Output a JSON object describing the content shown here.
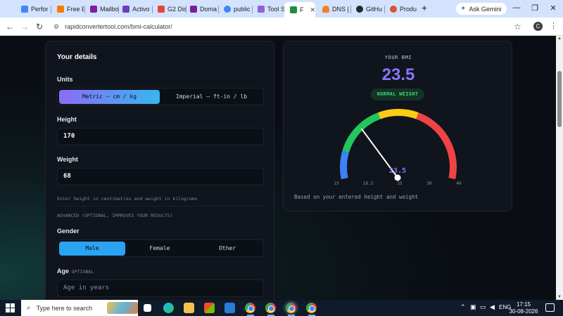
{
  "browser": {
    "tabs": [
      {
        "title": "Perfor",
        "color": "#4285f4"
      },
      {
        "title": "Free B",
        "color": "#f57c00"
      },
      {
        "title": "Mailbo",
        "color": "#7b1fa2"
      },
      {
        "title": "Activo",
        "color": "#6a3fc1"
      },
      {
        "title": "G2 Dis",
        "color": "#e8453c"
      },
      {
        "title": "Doma",
        "color": "#7b1fa2"
      },
      {
        "title": "public",
        "color": "#4285f4"
      },
      {
        "title": "Tool S",
        "color": "#8e63d9"
      },
      {
        "title": "Fr",
        "color": "#1e8e3e",
        "active": true
      },
      {
        "title": "DNS |",
        "color": "#f38020"
      },
      {
        "title": "GitHu",
        "color": "#24292e"
      },
      {
        "title": "Produ",
        "color": "#da552f"
      }
    ],
    "new_tab": "+",
    "ask_gemini": "Ask Gemini",
    "url": "rapidconvertertool.com/bmi-calculator/",
    "profile_initial": "C",
    "window_controls": {
      "minimize": "—",
      "restore": "❐",
      "close": "✕"
    }
  },
  "details": {
    "title": "Your details",
    "units_label": "Units",
    "units_options": [
      "Metric — cm / kg",
      "Imperial — ft-in / lb"
    ],
    "units_selected": 0,
    "height_label": "Height",
    "height_value": "170",
    "weight_label": "Weight",
    "weight_value": "68",
    "hint": "Enter height in centimetres and weight in kilograms",
    "advanced": "ADVANCED (OPTIONAL, IMPROVES YOUR RESULTS)",
    "gender_label": "Gender",
    "gender_options": [
      "Male",
      "Female",
      "Other"
    ],
    "gender_selected": 0,
    "age_label": "Age",
    "age_optional": "OPTIONAL",
    "age_placeholder": "Age in years"
  },
  "result": {
    "label": "YOUR BMI",
    "value": "23.5",
    "category": "NORMAL WEIGHT",
    "gauge_min": 15,
    "gauge_max": 40,
    "gauge_ticks": [
      "15",
      "18.5",
      "25",
      "30",
      "40"
    ],
    "gauge_zones": [
      {
        "from": 15,
        "to": 18.5,
        "color": "#3b82f6"
      },
      {
        "from": 18.5,
        "to": 25,
        "color": "#22c55e"
      },
      {
        "from": 25,
        "to": 30,
        "color": "#facc15"
      },
      {
        "from": 30,
        "to": 40,
        "color": "#ef4444"
      }
    ],
    "needle_value": 23.5,
    "footnote": "Based on your entered height and weight"
  },
  "taskbar": {
    "search_placeholder": "Type here to search",
    "language": "ENG",
    "time": "17:15",
    "date": "30-08-2026"
  },
  "colors": {
    "accent": "#8b74f5",
    "selected_blue": "#2aa3f3",
    "normal_green": "#3fd17a"
  }
}
